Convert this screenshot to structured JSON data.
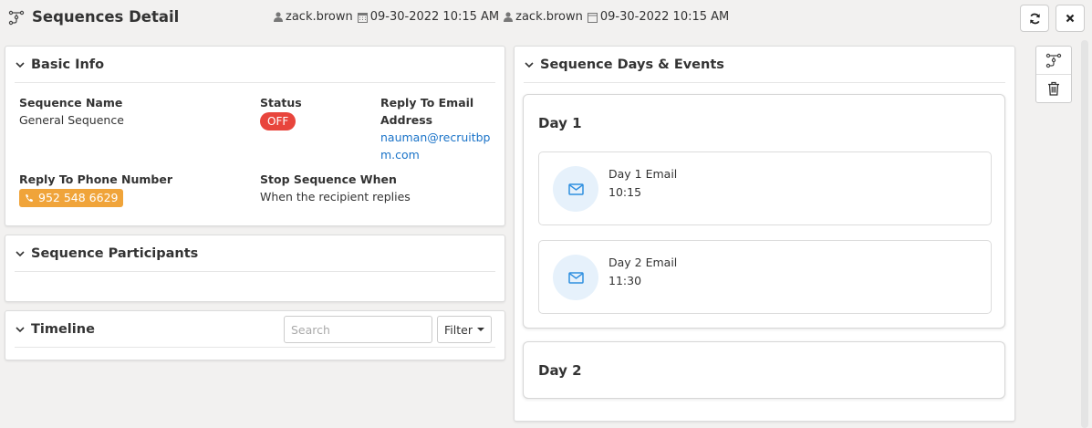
{
  "header": {
    "title": "Sequences Detail",
    "created_by": "zack.brown",
    "created_at": "09-30-2022 10:15 AM",
    "modified_by": "zack.brown",
    "modified_at": "09-30-2022 10:15 AM"
  },
  "basic_info": {
    "title": "Basic Info",
    "sequence_name_label": "Sequence Name",
    "sequence_name": "General Sequence",
    "status_label": "Status",
    "status": "OFF",
    "reply_email_label_line1": "Reply To Email",
    "reply_email_label_line2": "Address",
    "reply_email_line1": "nauman@recruitbp",
    "reply_email_line2": "m.com",
    "reply_phone_label": "Reply To Phone Number",
    "reply_phone": "952 548 6629",
    "stop_when_label": "Stop Sequence When",
    "stop_when": "When the recipient replies"
  },
  "participants": {
    "title": "Sequence Participants"
  },
  "timeline": {
    "title": "Timeline",
    "search_placeholder": "Search",
    "filter_label": "Filter"
  },
  "days_events": {
    "title": "Sequence Days & Events",
    "days": [
      {
        "label": "Day 1",
        "events": [
          {
            "name": "Day 1 Email",
            "time": "10:15"
          },
          {
            "name": "Day 2 Email",
            "time": "11:30"
          }
        ]
      },
      {
        "label": "Day 2",
        "events": []
      }
    ]
  },
  "icons": {
    "page": "sequence-icon",
    "user": "user-icon",
    "calendar": "calendar-icon",
    "refresh": "refresh-icon",
    "close": "close-icon",
    "email": "envelope-icon",
    "phone": "phone-icon",
    "trash": "trash-icon"
  },
  "colors": {
    "status_off": "#e8453c",
    "phone_badge": "#f0a43a",
    "link": "#1a73c8",
    "email_icon_bg": "#e6f1fb",
    "email_icon": "#2f8fe0"
  }
}
